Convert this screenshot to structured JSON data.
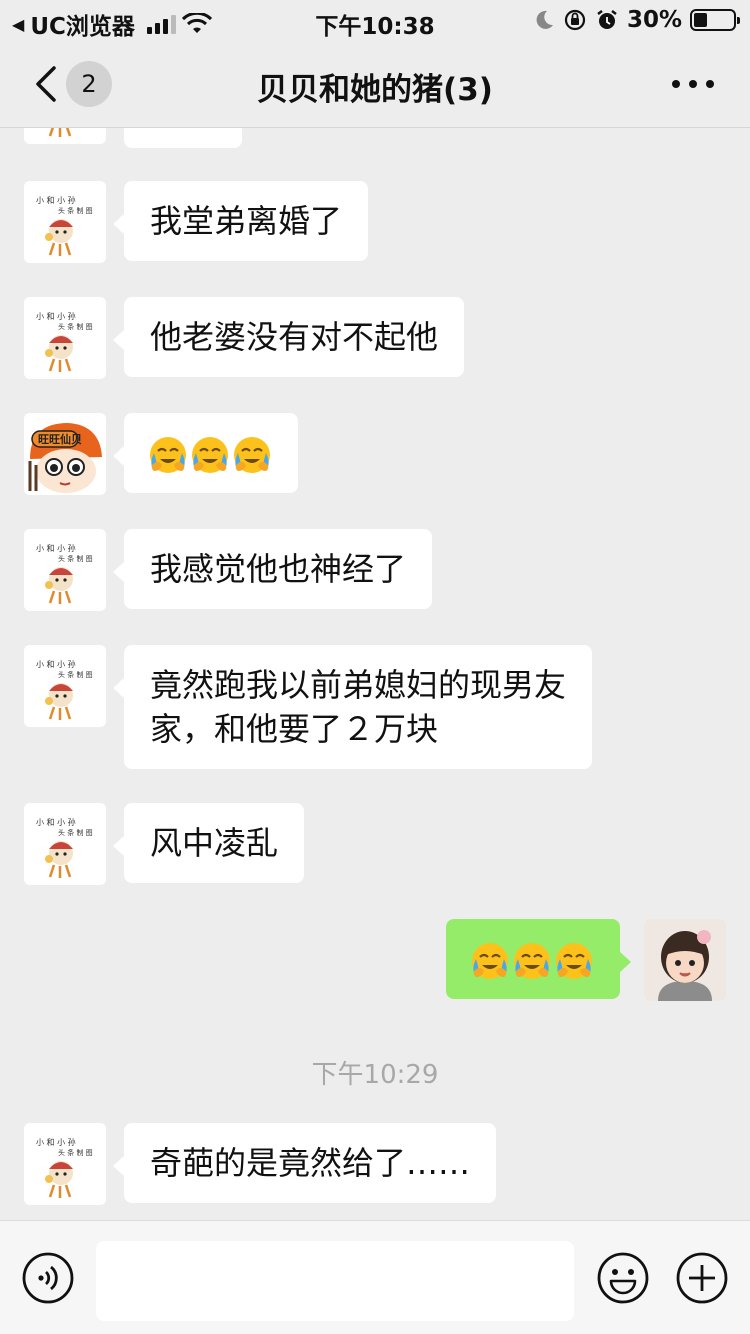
{
  "status_bar": {
    "app_name": "UC浏览器",
    "time": "下午10:38",
    "battery": "30%"
  },
  "nav": {
    "unread_count": "2",
    "title": "贝贝和她的猪(3)"
  },
  "messages": [
    {
      "sender": "friend",
      "text": "我堂弟离婚了"
    },
    {
      "sender": "friend",
      "text": "他老婆没有对不起他"
    },
    {
      "sender": "friend_b",
      "emoji": [
        "facepalm-cry-emoji",
        "facepalm-cry-emoji",
        "facepalm-cry-emoji"
      ]
    },
    {
      "sender": "friend",
      "text": "我感觉他也神经了"
    },
    {
      "sender": "friend",
      "line1": "竟然跑我以前弟媳妇的现男友",
      "line2": "家，和他要了２万块"
    },
    {
      "sender": "friend",
      "text": "风中凌乱"
    },
    {
      "sender": "self",
      "emoji": [
        "facepalm-cry-emoji",
        "facepalm-cry-emoji",
        "facepalm-cry-emoji"
      ]
    },
    {
      "sender": "friend",
      "text": "奇葩的是竟然给了……"
    }
  ],
  "timestamp": "下午10:29",
  "colors": {
    "background": "#ededed",
    "self_bubble": "#95ec69",
    "friend_bubble": "#ffffff"
  }
}
